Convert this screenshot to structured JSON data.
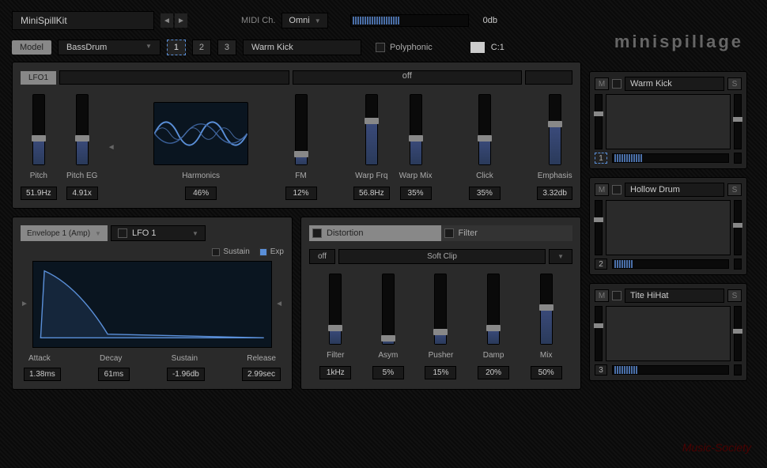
{
  "topbar": {
    "preset": "MiniSpillKit",
    "midi_label": "MIDI Ch.",
    "midi_value": "Omni",
    "db": "0db"
  },
  "logo": "minispillage",
  "model_row": {
    "model_label": "Model",
    "model_value": "BassDrum",
    "pads": [
      "1",
      "2",
      "3"
    ],
    "patch": "Warm Kick",
    "poly": "Polyphonic",
    "note": "C:1"
  },
  "lfo": {
    "label": "LFO1",
    "state": "off"
  },
  "osc_sliders": [
    {
      "label": "Pitch",
      "value": "51.9Hz",
      "fill": 35
    },
    {
      "label": "Pitch EG",
      "value": "4.91x",
      "fill": 35
    }
  ],
  "harmonics": {
    "label": "Harmonics",
    "value": "46%"
  },
  "mod_sliders": [
    {
      "label": "FM",
      "value": "12%",
      "fill": 12
    },
    {
      "label": "Warp Frq",
      "value": "56.8Hz",
      "fill": 60
    },
    {
      "label": "Warp Mix",
      "value": "35%",
      "fill": 35
    },
    {
      "label": "Click",
      "value": "35%",
      "fill": 35
    },
    {
      "label": "Emphasis",
      "value": "3.32db",
      "fill": 55
    }
  ],
  "envelope": {
    "selector": "Envelope 1 (Amp)",
    "lfo": "LFO 1",
    "sustain_opt": "Sustain",
    "exp_opt": "Exp",
    "params": [
      {
        "label": "Attack",
        "value": "1.38ms"
      },
      {
        "label": "Decay",
        "value": "61ms"
      },
      {
        "label": "Sustain",
        "value": "-1.96db"
      },
      {
        "label": "Release",
        "value": "2.99sec"
      }
    ]
  },
  "distortion": {
    "tab1": "Distortion",
    "tab2": "Filter",
    "mode_off": "off",
    "mode": "Soft Clip",
    "sliders": [
      {
        "label": "Filter",
        "value": "1kHz",
        "fill": 20
      },
      {
        "label": "Asym",
        "value": "5%",
        "fill": 5
      },
      {
        "label": "Pusher",
        "value": "15%",
        "fill": 15
      },
      {
        "label": "Damp",
        "value": "20%",
        "fill": 20
      },
      {
        "label": "Mix",
        "value": "50%",
        "fill": 50
      }
    ]
  },
  "pads": [
    {
      "num": "1",
      "name": "Warm Kick",
      "active": true
    },
    {
      "num": "2",
      "name": "Hollow Drum",
      "active": false
    },
    {
      "num": "3",
      "name": "Tite HiHat",
      "active": false
    }
  ],
  "watermark": "Music-Society"
}
